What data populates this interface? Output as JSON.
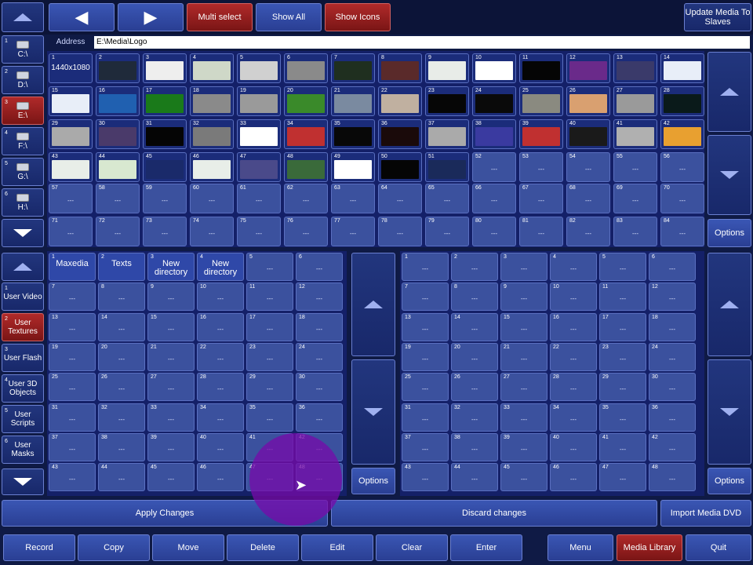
{
  "top_toolbar": {
    "back_label": "",
    "forward_label": "",
    "multi_select": "Multi select",
    "show_all": "Show All",
    "show_icons": "Show Icons",
    "update_media": "Update Media To Slaves"
  },
  "address": {
    "label": "Address",
    "value": "E:\\Media\\Logo"
  },
  "drives": [
    {
      "num": "1",
      "label": "C:\\"
    },
    {
      "num": "2",
      "label": "D:\\"
    },
    {
      "num": "3",
      "label": "E:\\"
    },
    {
      "num": "4",
      "label": "F:\\"
    },
    {
      "num": "5",
      "label": "G:\\"
    },
    {
      "num": "6",
      "label": "H:\\"
    }
  ],
  "media_grid": {
    "first": "1440x1080",
    "placeholder": "---",
    "options": "Options",
    "count": 84,
    "thumb_colors": [
      "",
      "#1f2a3a",
      "#eeeeee",
      "#cfd8c8",
      "#d0d0d0",
      "#8a8a8a",
      "#1f2f1f",
      "#5a2a2a",
      "#e8ece8",
      "#ffffff",
      "#050505",
      "#6a2a8a",
      "#3a3a6a",
      "#e8eef8",
      "#e8eef8",
      "#2060b0",
      "#1a7a1a",
      "#8a8a8a",
      "#9a9a9a",
      "#3a8a2a",
      "#7a8aa0",
      "#c0b0a0",
      "#060606",
      "#0a0a0a",
      "#8a8a80",
      "#d9a070",
      "#9a9a9a",
      "#0a1a1a",
      "#aaaaaa",
      "#4a3a6a",
      "#050505",
      "#7a7a7a",
      "#ffffff",
      "#c03030",
      "#080808",
      "#1a0a0a",
      "#aaaaaa",
      "#3a3aa0",
      "#c03030",
      "#1a1a1a",
      "#b0b0b0",
      "#e8a030",
      "#e8eee8",
      "#d8e8d0",
      "#1a2a6a",
      "#e8eee8",
      "#4a4a8a",
      "#3a6a3a",
      "#ffffff",
      "#050505",
      "#1a2a5a"
    ]
  },
  "categories": [
    {
      "num": "1",
      "label": "User Video"
    },
    {
      "num": "2",
      "label": "User Textures"
    },
    {
      "num": "3",
      "label": "User Flash"
    },
    {
      "num": "4",
      "label": "User 3D Objects"
    },
    {
      "num": "5",
      "label": "User Scripts"
    },
    {
      "num": "6",
      "label": "User Masks"
    }
  ],
  "library_grid": {
    "named": [
      {
        "num": "1",
        "label": "Maxedia"
      },
      {
        "num": "2",
        "label": "Texts"
      },
      {
        "num": "3",
        "label": "New directory"
      },
      {
        "num": "4",
        "label": "New directory"
      }
    ],
    "placeholder": "---",
    "count": 48,
    "options": "Options"
  },
  "right_grid": {
    "placeholder": "---",
    "count": 48,
    "options": "Options"
  },
  "apply_bar": {
    "apply": "Apply Changes",
    "discard": "Discard changes",
    "import": "Import Media DVD"
  },
  "bottom_toolbar": {
    "record": "Record",
    "copy": "Copy",
    "move": "Move",
    "delete": "Delete",
    "edit": "Edit",
    "clear": "Clear",
    "enter": "Enter",
    "menu": "Menu",
    "media_library": "Media Library",
    "quit": "Quit"
  }
}
